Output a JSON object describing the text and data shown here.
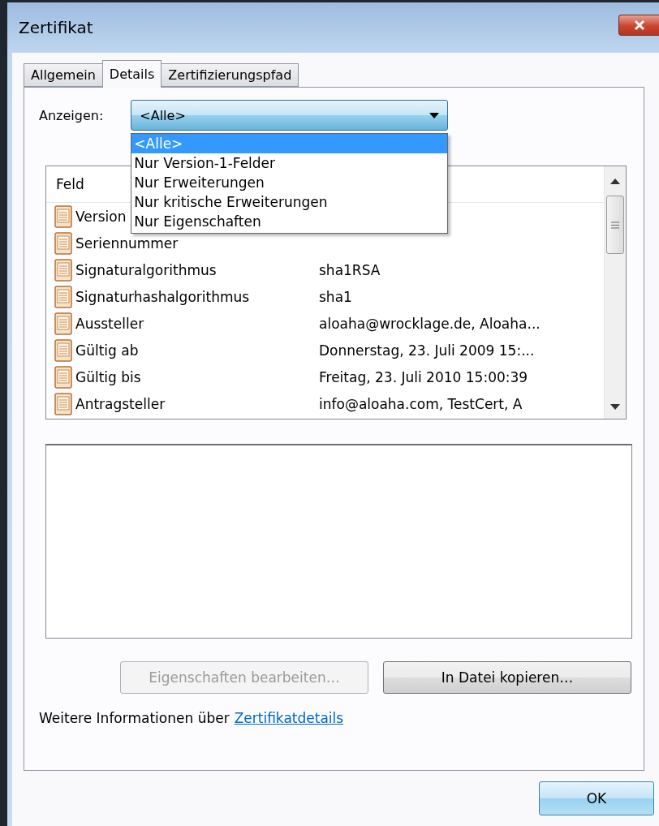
{
  "window": {
    "title": "Zertifikat"
  },
  "tabs": [
    {
      "label": "Allgemein",
      "selected": false
    },
    {
      "label": "Details",
      "selected": true
    },
    {
      "label": "Zertifizierungspfad",
      "selected": false
    }
  ],
  "show": {
    "label": "Anzeigen:",
    "value": "<Alle>",
    "expanded": true,
    "options": [
      {
        "label": "<Alle>",
        "selected": true
      },
      {
        "label": "Nur Version-1-Felder",
        "selected": false
      },
      {
        "label": "Nur Erweiterungen",
        "selected": false
      },
      {
        "label": "Nur kritische Erweiterungen",
        "selected": false
      },
      {
        "label": "Nur Eigenschaften",
        "selected": false
      }
    ]
  },
  "fields": {
    "columns": [
      "Feld"
    ],
    "rows": [
      {
        "field": "Version"
      },
      {
        "field": "Seriennummer"
      },
      {
        "field": "Signaturalgorithmus",
        "value": "sha1RSA"
      },
      {
        "field": "Signaturhashalgorithmus",
        "value": "sha1"
      },
      {
        "field": "Aussteller",
        "value": "aloaha@wrocklage.de, Aloaha..."
      },
      {
        "field": "Gültig ab",
        "value": "Donnerstag, 23. Juli 2009 15:..."
      },
      {
        "field": "Gültig bis",
        "value": "Freitag, 23. Juli 2010 15:00:39"
      },
      {
        "field": "Antragsteller",
        "value": "info@aloaha.com, TestCert, A"
      }
    ]
  },
  "buttons": [
    {
      "label": "Eigenschaften bearbeiten…",
      "disabled": true
    },
    {
      "label": "In Datei kopieren…",
      "disabled": false
    }
  ],
  "info": {
    "text": "Weitere Informationen über",
    "link": "Zertifikatdetails"
  },
  "ok_button": "OK"
}
